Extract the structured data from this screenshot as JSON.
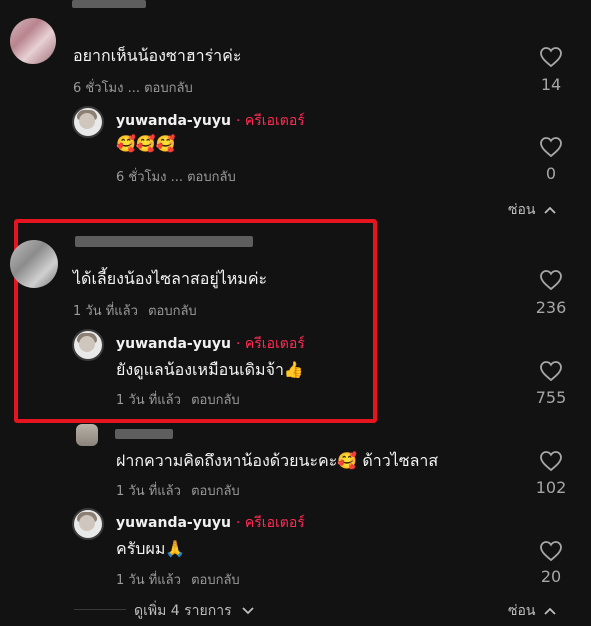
{
  "comments": [
    {
      "text": "อยากเห็นน้องซาฮาร่าค่ะ",
      "time": "6 ชั่วโมง",
      "reply": "ตอบกลับ",
      "likes": "14",
      "replies": [
        {
          "username": "yuwanda-yuyu",
          "badge": "· ครีเอเตอร์",
          "text": "🥰🥰🥰",
          "time": "6 ชั่วโมง",
          "reply": "ตอบกลับ",
          "likes": "0"
        }
      ],
      "hide_label": "ซ่อน"
    },
    {
      "text": "ได้เลี้ยงน้องไซลาสอยู่ไหมค่ะ",
      "time": "1 วัน ที่แล้ว",
      "reply": "ตอบกลับ",
      "likes": "236",
      "replies": [
        {
          "username": "yuwanda-yuyu",
          "badge": "· ครีเอเตอร์",
          "text": "ยังดูแลน้องเหมือนเดิมจ้า👍",
          "time": "1 วัน ที่แล้ว",
          "reply": "ตอบกลับ",
          "likes": "755"
        },
        {
          "text": "ฝากความคิดถึงหาน้องด้วยนะคะ🥰 ด้าวไซลาส",
          "time": "1 วัน ที่แล้ว",
          "reply": "ตอบกลับ",
          "likes": "102"
        },
        {
          "username": "yuwanda-yuyu",
          "badge": "· ครีเอเตอร์",
          "text": "ครับผม🙏",
          "time": "1 วัน ที่แล้ว",
          "reply": "ตอบกลับ",
          "likes": "20"
        }
      ],
      "more_label": "ดูเพิ่ม 4 รายการ",
      "hide_label": "ซ่อน"
    }
  ],
  "icons": {
    "like": "heart-outline-icon",
    "expand": "chevron-down-icon",
    "collapse": "chevron-up-icon"
  },
  "colors": {
    "background": "#121212",
    "creator_badge": "#fe2c55",
    "highlight_box": "#e5141f"
  }
}
